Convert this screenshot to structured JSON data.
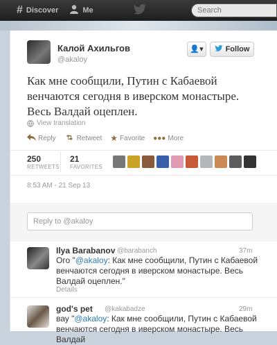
{
  "nav": {
    "discover_label": "Discover",
    "me_label": "Me",
    "search_placeholder": "Search"
  },
  "tweet": {
    "author_name": "Калой Ахильгов",
    "author_handle": "@akaloy",
    "follow_label": "Follow",
    "text": "Как мне сообщили, Путин с Кабаевой венчаются сегодня в иверском монастыре. Весь Валдай оцеплен.",
    "translate_label": "View translation",
    "actions": {
      "reply": "Reply",
      "retweet": "Retweet",
      "favorite": "Favorite",
      "more": "More"
    },
    "stats": {
      "retweets_count": "250",
      "retweets_label": "RETWEETS",
      "favorites_count": "21",
      "favorites_label": "FAVORITES"
    },
    "timestamp": "8:53 AM - 21 Sep 13"
  },
  "reply_box": {
    "placeholder": "Reply to @akaloy"
  },
  "replies": [
    {
      "name": "Ilya Barabanov",
      "handle": "@barabanch",
      "time": "37m",
      "prefix": "Ого \"",
      "mention": "@akaloy",
      "body": ": Как мне сообщили, Путин с Кабаевой венчаются сегодня в иверском монастыре. Весь Валдай оцеплен.\"",
      "details": "Details"
    },
    {
      "name": "god's pet",
      "handle": "@kakabadze",
      "time": "29m",
      "prefix": "вау \"",
      "mention": "@akaloy",
      "body": ": Как мне сообщили, Путин с Кабаевой венчаются сегодня в иверском монастыре. Весь Валдай",
      "details": ""
    }
  ],
  "colors": {
    "link": "#2b7bb9",
    "follow_bird": "#2b9bd8",
    "topbar": "#2a2a2a"
  }
}
